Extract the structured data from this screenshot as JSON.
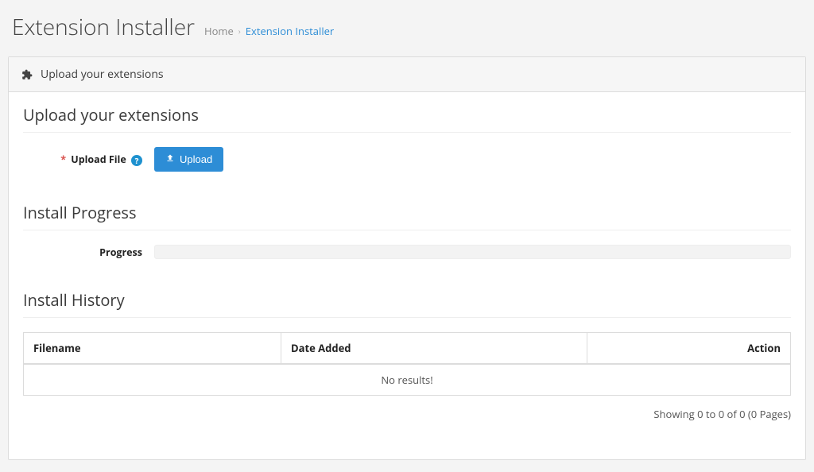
{
  "header": {
    "page_title": "Extension Installer",
    "breadcrumb": {
      "home": "Home",
      "current": "Extension Installer"
    }
  },
  "panel": {
    "heading": "Upload your extensions"
  },
  "upload_section": {
    "title": "Upload your extensions",
    "label": "Upload File",
    "button": "Upload"
  },
  "progress_section": {
    "title": "Install Progress",
    "label": "Progress"
  },
  "history_section": {
    "title": "Install History",
    "columns": {
      "filename": "Filename",
      "date_added": "Date Added",
      "action": "Action"
    },
    "empty_text": "No results!",
    "pagination": "Showing 0 to 0 of 0 (0 Pages)"
  }
}
